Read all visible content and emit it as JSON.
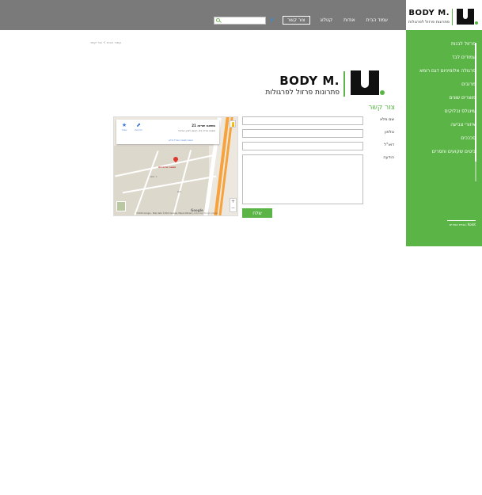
{
  "header": {
    "logo": {
      "text": "BODY M.",
      "tagline": "פתרונות פרזול לפרגולות"
    },
    "nav": [
      {
        "label": "עמוד הבית"
      },
      {
        "label": "אודות"
      },
      {
        "label": "קטלוג"
      }
    ],
    "contact_button": "צור קשר",
    "facebook_icon": "f",
    "search": {
      "placeholder": "חיפוש..."
    }
  },
  "sidebar": {
    "items": [
      {
        "label": "פרזול לבנות"
      },
      {
        "label": "עמודים לבד"
      },
      {
        "label": "פרגולה אלומיניום דגם רומא"
      },
      {
        "label": "מרובים"
      },
      {
        "label": "מוצרים שונים"
      },
      {
        "label": "שינגלס ובלוקים"
      },
      {
        "label": "איזורי צביעה"
      },
      {
        "label": "סכככים"
      },
      {
        "label": "ביטים שקועים וחסרים"
      }
    ],
    "credit": "בניית אתרים: Kolot"
  },
  "breadcrumb": "עמוד הבית > צור קשר",
  "main_logo": {
    "text": "BODY M.",
    "tagline": "פתרונות פרזול לפרגולות"
  },
  "contact": {
    "title": "צור קשר",
    "fields": [
      {
        "label": "שם מלא"
      },
      {
        "label": "טלפון"
      },
      {
        "label": "דוא\"ל"
      },
      {
        "label": "הודעה"
      }
    ],
    "send_label": "שלח"
  },
  "map": {
    "card_title": "משאה שרזה 21",
    "card_address": "משאה שרזה 21, ראשון לציון, ישראל",
    "card_link": "הצגת תמונה בגודל מלא",
    "directions_label": "הוראות",
    "save_label": "שמור",
    "pin_label": "משאה שרזה 21",
    "google_label": "Google",
    "footer": "©2014 Google - Map data ©2014 Google, Mapa GISrael | תנאים | דווח על בעיה במפה",
    "zoom_in": "+",
    "zoom_out": "−",
    "street_labels": [
      "יד משה",
      "חיים"
    ]
  },
  "colors": {
    "accent": "#5bb546",
    "topbar": "#7a7a7a",
    "map_highway": "#f7a23a"
  }
}
